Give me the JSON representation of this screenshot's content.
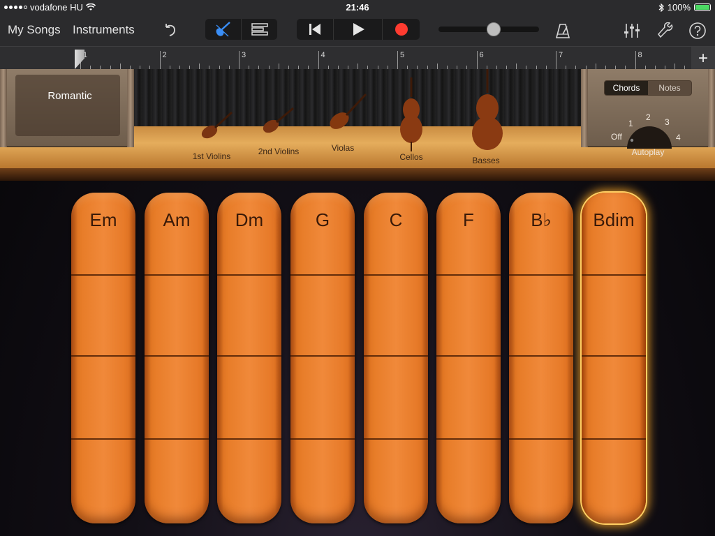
{
  "status_bar": {
    "carrier": "vodafone HU",
    "time": "21:46",
    "battery": "100%"
  },
  "toolbar": {
    "my_songs": "My Songs",
    "instruments": "Instruments"
  },
  "ruler": {
    "bars": [
      "1",
      "2",
      "3",
      "4",
      "5",
      "6",
      "7",
      "8"
    ],
    "add_label": "+"
  },
  "stage": {
    "title": "Romantic",
    "instruments": [
      "1st Violins",
      "2nd Violins",
      "Violas",
      "Cellos",
      "Basses"
    ]
  },
  "mode": {
    "chords": "Chords",
    "notes": "Notes",
    "selected": "Chords"
  },
  "autoplay": {
    "label": "Autoplay",
    "off": "Off",
    "settings": [
      "1",
      "2",
      "3",
      "4"
    ]
  },
  "chords": {
    "items": [
      "Em",
      "Am",
      "Dm",
      "G",
      "C",
      "F",
      "B♭",
      "Bdim"
    ],
    "selected": "Bdim"
  },
  "colors": {
    "strip_orange": "#f0893a",
    "record_red": "#ff3b30",
    "active_blue": "#3a8ef6",
    "battery_green": "#4cd964"
  },
  "icons": [
    "wifi-icon",
    "bluetooth-icon",
    "battery-icon",
    "undo-icon",
    "violin-icon",
    "tracks-view-icon",
    "rewind-icon",
    "play-icon",
    "record-icon",
    "metronome-icon",
    "mixer-icon",
    "wrench-icon",
    "help-icon"
  ]
}
